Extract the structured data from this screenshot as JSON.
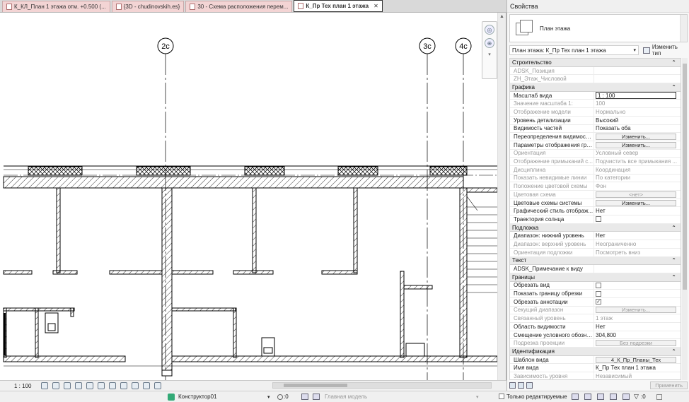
{
  "tabs": [
    {
      "label": "К_КЛ_План 1 этажа  отм. +0.500 (..."
    },
    {
      "label": "{3D - chudinovskih.es}"
    },
    {
      "label": "30 - Схема расположения перем..."
    },
    {
      "label": "К_Пр Тех план 1 этажа"
    }
  ],
  "grid_labels": [
    "2c",
    "3c",
    "4c"
  ],
  "view_bar": {
    "scale": "1 : 100"
  },
  "status_bar": {
    "user": "Конструктор01",
    "count": ":0",
    "model": "Главная модель",
    "editable_only": "Только редактируемые",
    "filter_count": ":0"
  },
  "properties": {
    "title": "Свойства",
    "type_name": "План этажа",
    "instance_filter": "План этажа: К_Пр Тех план 1 этажа",
    "edit_type": "Изменить тип",
    "sections": [
      {
        "label": "Строительство",
        "rows": [
          {
            "name": "ADSK_Позиция",
            "value": "",
            "disabled": true
          },
          {
            "name": "ZH_Этаж_Числовой",
            "value": "",
            "disabled": true
          }
        ]
      },
      {
        "label": "Графика",
        "rows": [
          {
            "name": "Масштаб вида",
            "value": "1 : 100",
            "kind": "input"
          },
          {
            "name": "Значение масштаба    1:",
            "value": "100",
            "disabled": true
          },
          {
            "name": "Отображение модели",
            "value": "Нормально",
            "disabled": true
          },
          {
            "name": "Уровень детализации",
            "value": "Высокий"
          },
          {
            "name": "Видимость частей",
            "value": "Показать оба"
          },
          {
            "name": "Переопределения видимости...",
            "value": "Изменить...",
            "kind": "button"
          },
          {
            "name": "Параметры отображения гра...",
            "value": "Изменить...",
            "kind": "button"
          },
          {
            "name": "Ориентация",
            "value": "Условный север",
            "disabled": true
          },
          {
            "name": "Отображение примыканий с...",
            "value": "Подчистить все примыкания ...",
            "disabled": true
          },
          {
            "name": "Дисциплина",
            "value": "Координация",
            "disabled": true
          },
          {
            "name": "Показать невидимые линии",
            "value": "По категории",
            "disabled": true
          },
          {
            "name": "Положение цветовой схемы",
            "value": "Фон",
            "disabled": true
          },
          {
            "name": "Цветовая схема",
            "value": "<нет>",
            "kind": "button",
            "disabled": true
          },
          {
            "name": "Цветовые схемы системы",
            "value": "Изменить...",
            "kind": "button"
          },
          {
            "name": "Графический стиль отображ...",
            "value": "Нет"
          },
          {
            "name": "Траектория солнца",
            "value": "",
            "kind": "checkbox",
            "checked": false
          }
        ]
      },
      {
        "label": "Подложка",
        "rows": [
          {
            "name": "Диапазон: нижний уровень",
            "value": "Нет"
          },
          {
            "name": "Диапазон: верхний уровень",
            "value": "Неограниченно",
            "disabled": true
          },
          {
            "name": "Ориентация подложки",
            "value": "Посмотреть вниз",
            "disabled": true
          }
        ]
      },
      {
        "label": "Текст",
        "rows": [
          {
            "name": "ADSK_Примечание к виду",
            "value": ""
          }
        ]
      },
      {
        "label": "Границы",
        "rows": [
          {
            "name": "Обрезать вид",
            "value": "",
            "kind": "checkbox",
            "checked": false
          },
          {
            "name": "Показать границу обрезки",
            "value": "",
            "kind": "checkbox",
            "checked": false
          },
          {
            "name": "Обрезать аннотации",
            "value": "",
            "kind": "checkbox",
            "checked": true
          },
          {
            "name": "Секущий диапазон",
            "value": "Изменить...",
            "kind": "button",
            "disabled": true
          },
          {
            "name": "Связанный уровень",
            "value": "1 этаж",
            "disabled": true
          },
          {
            "name": "Область видимости",
            "value": "Нет"
          },
          {
            "name": "Смещение условного обозна...",
            "value": "304,800"
          },
          {
            "name": "Подрезка проекции",
            "value": "Без подрезки",
            "kind": "button",
            "disabled": true
          }
        ]
      },
      {
        "label": "Идентификация",
        "rows": [
          {
            "name": "Шаблон вида",
            "value": "4_К_Пр_Планы_Тех",
            "kind": "button"
          },
          {
            "name": "Имя вида",
            "value": "К_Пр Тех план 1 этажа"
          },
          {
            "name": "Зависимость уровня",
            "value": "Независимый",
            "disabled": true
          }
        ]
      }
    ],
    "apply_label": "Применить"
  }
}
